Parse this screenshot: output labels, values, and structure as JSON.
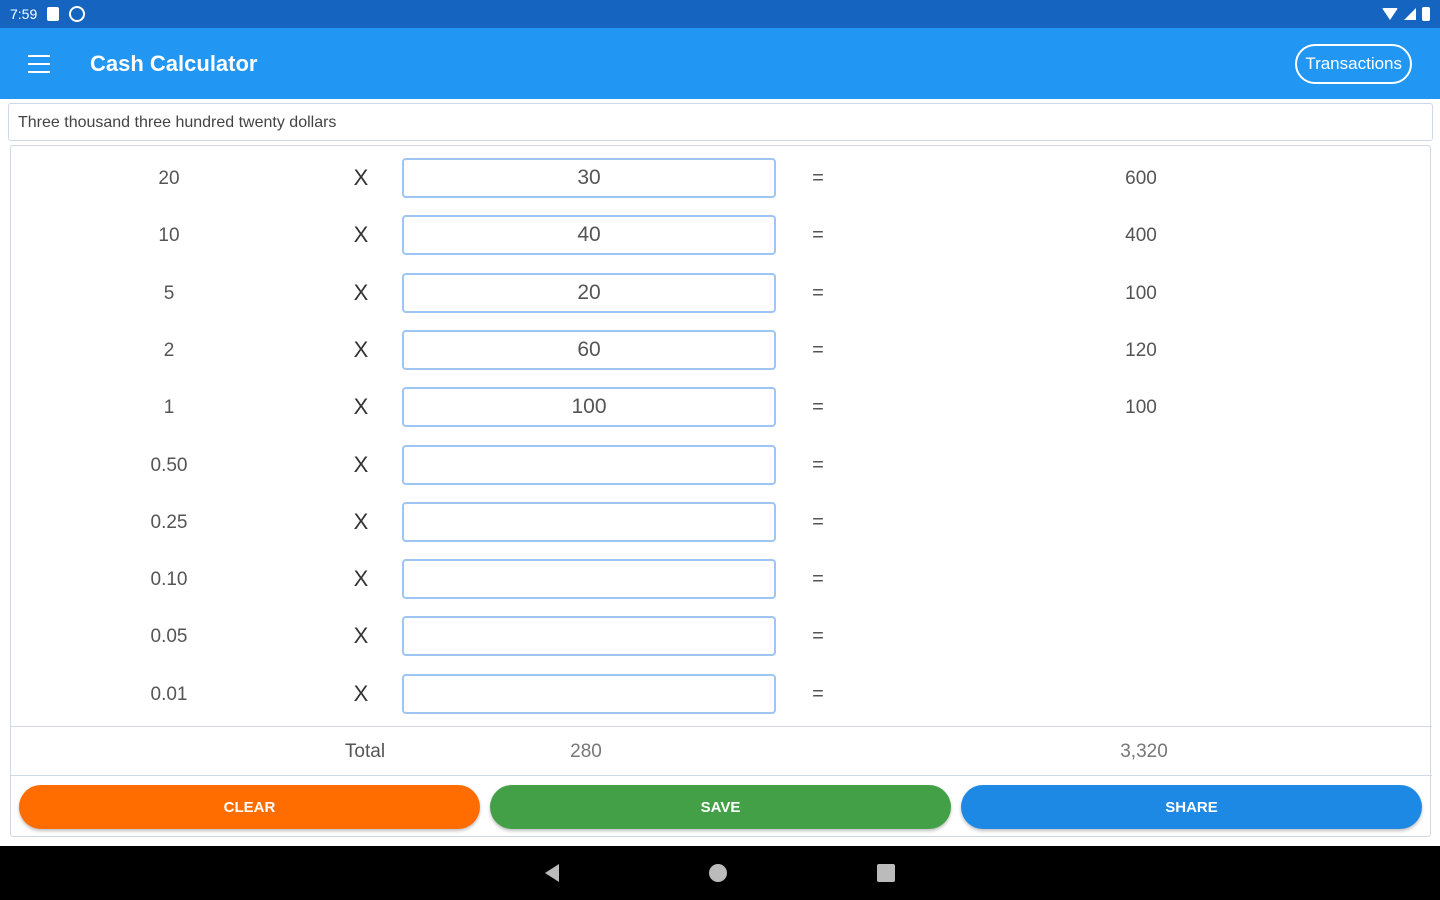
{
  "status_bar": {
    "time": "7:59"
  },
  "app_bar": {
    "title": "Cash Calculator",
    "transactions_label": "Transactions"
  },
  "words": "Three thousand three hundred twenty dollars",
  "symbols": {
    "multiply": "X",
    "equals": "="
  },
  "rows": [
    {
      "denomination": "20",
      "quantity": "30",
      "amount": "600"
    },
    {
      "denomination": "10",
      "quantity": "40",
      "amount": "400"
    },
    {
      "denomination": "5",
      "quantity": "20",
      "amount": "100"
    },
    {
      "denomination": "2",
      "quantity": "60",
      "amount": "120"
    },
    {
      "denomination": "1",
      "quantity": "100",
      "amount": "100"
    },
    {
      "denomination": "0.50",
      "quantity": "",
      "amount": ""
    },
    {
      "denomination": "0.25",
      "quantity": "",
      "amount": ""
    },
    {
      "denomination": "0.10",
      "quantity": "",
      "amount": ""
    },
    {
      "denomination": "0.05",
      "quantity": "",
      "amount": ""
    },
    {
      "denomination": "0.01",
      "quantity": "",
      "amount": ""
    }
  ],
  "total": {
    "label": "Total",
    "count": "280",
    "sum": "3,320"
  },
  "buttons": {
    "clear": "CLEAR",
    "save": "SAVE",
    "share": "SHARE"
  },
  "colors": {
    "status_bar": "#1565c0",
    "app_bar": "#2196f3",
    "clear": "#ff6d00",
    "save": "#43a047",
    "share": "#1e88e5"
  }
}
